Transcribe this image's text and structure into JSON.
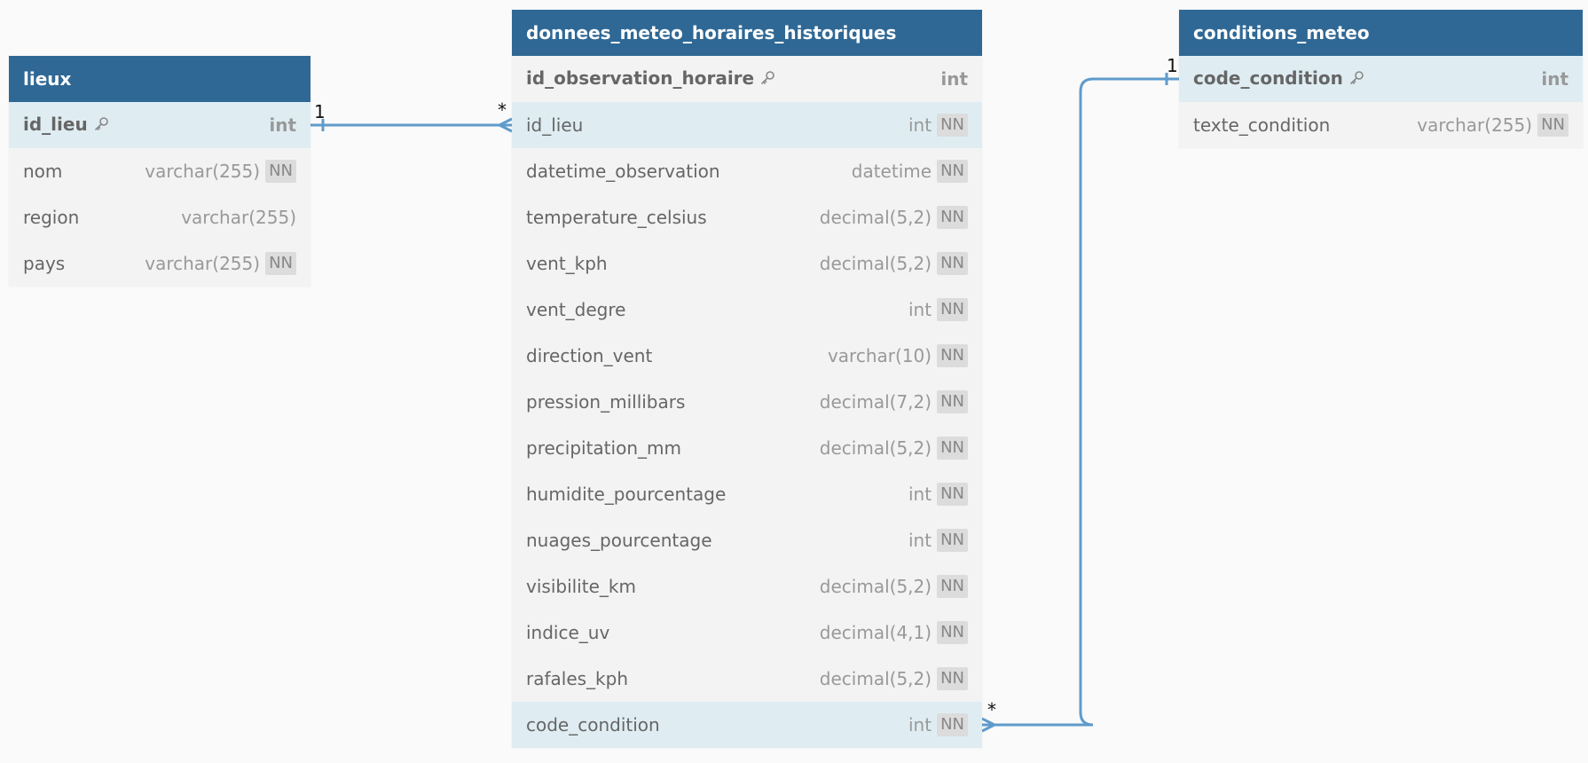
{
  "tables": [
    {
      "id": "lieux",
      "name": "lieux",
      "fields": [
        {
          "name": "id_lieu",
          "type": "int",
          "pk": true,
          "nn": false,
          "highlight": true
        },
        {
          "name": "nom",
          "type": "varchar(255)",
          "pk": false,
          "nn": true,
          "highlight": false
        },
        {
          "name": "region",
          "type": "varchar(255)",
          "pk": false,
          "nn": false,
          "highlight": false
        },
        {
          "name": "pays",
          "type": "varchar(255)",
          "pk": false,
          "nn": true,
          "highlight": false
        }
      ]
    },
    {
      "id": "donnees",
      "name": "donnees_meteo_horaires_historiques",
      "fields": [
        {
          "name": "id_observation_horaire",
          "type": "int",
          "pk": true,
          "nn": false,
          "highlight": false
        },
        {
          "name": "id_lieu",
          "type": "int",
          "pk": false,
          "nn": true,
          "highlight": true
        },
        {
          "name": "datetime_observation",
          "type": "datetime",
          "pk": false,
          "nn": true,
          "highlight": false
        },
        {
          "name": "temperature_celsius",
          "type": "decimal(5,2)",
          "pk": false,
          "nn": true,
          "highlight": false
        },
        {
          "name": "vent_kph",
          "type": "decimal(5,2)",
          "pk": false,
          "nn": true,
          "highlight": false
        },
        {
          "name": "vent_degre",
          "type": "int",
          "pk": false,
          "nn": true,
          "highlight": false
        },
        {
          "name": "direction_vent",
          "type": "varchar(10)",
          "pk": false,
          "nn": true,
          "highlight": false
        },
        {
          "name": "pression_millibars",
          "type": "decimal(7,2)",
          "pk": false,
          "nn": true,
          "highlight": false
        },
        {
          "name": "precipitation_mm",
          "type": "decimal(5,2)",
          "pk": false,
          "nn": true,
          "highlight": false
        },
        {
          "name": "humidite_pourcentage",
          "type": "int",
          "pk": false,
          "nn": true,
          "highlight": false
        },
        {
          "name": "nuages_pourcentage",
          "type": "int",
          "pk": false,
          "nn": true,
          "highlight": false
        },
        {
          "name": "visibilite_km",
          "type": "decimal(5,2)",
          "pk": false,
          "nn": true,
          "highlight": false
        },
        {
          "name": "indice_uv",
          "type": "decimal(4,1)",
          "pk": false,
          "nn": true,
          "highlight": false
        },
        {
          "name": "rafales_kph",
          "type": "decimal(5,2)",
          "pk": false,
          "nn": true,
          "highlight": false
        },
        {
          "name": "code_condition",
          "type": "int",
          "pk": false,
          "nn": true,
          "highlight": true
        }
      ]
    },
    {
      "id": "conditions",
      "name": "conditions_meteo",
      "fields": [
        {
          "name": "code_condition",
          "type": "int",
          "pk": true,
          "nn": false,
          "highlight": true
        },
        {
          "name": "texte_condition",
          "type": "varchar(255)",
          "pk": false,
          "nn": true,
          "highlight": false
        }
      ]
    }
  ],
  "nn_label": "NN",
  "relations": [
    {
      "from_table": "lieux",
      "from_field": "id_lieu",
      "from_card": "1",
      "to_table": "donnees",
      "to_field": "id_lieu",
      "to_card": "*"
    },
    {
      "from_table": "conditions",
      "from_field": "code_condition",
      "from_card": "1",
      "to_table": "donnees",
      "to_field": "code_condition",
      "to_card": "*"
    }
  ],
  "colors": {
    "header": "#2f6895",
    "row_bg": "#f3f3f3",
    "highlight_bg": "#dfedf3",
    "relation_line": "#5f9bcb",
    "background": "#fafafa"
  },
  "icons": {
    "primary_key": "key-icon"
  }
}
